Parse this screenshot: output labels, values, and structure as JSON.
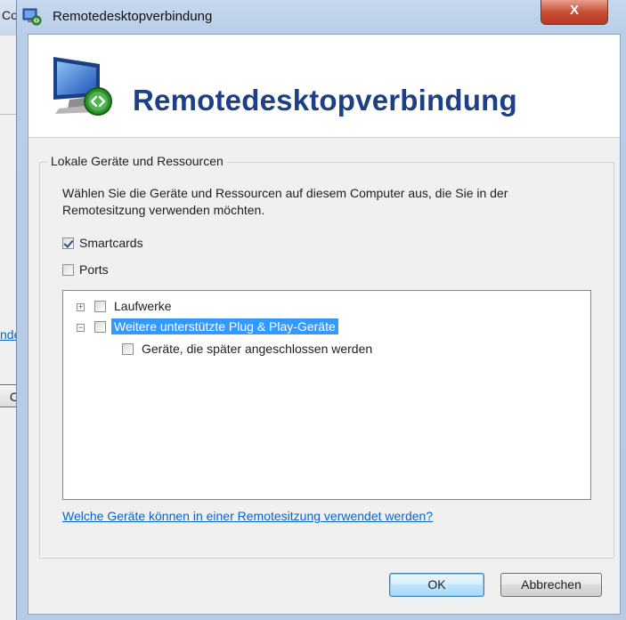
{
  "background_window": {
    "title_fragment": "Co",
    "link_fragment": "nde",
    "button_fragment": "C"
  },
  "dialog": {
    "title": "Remotedesktopverbindung",
    "close_label": "X",
    "banner_title": "Remotedesktopverbindung",
    "group_title": "Lokale Geräte und Ressourcen",
    "description": "Wählen Sie die Geräte und Ressourcen auf diesem Computer aus, die Sie in der Remotesitzung verwenden möchten.",
    "checkboxes": [
      {
        "label": "Smartcards",
        "checked": true
      },
      {
        "label": "Ports",
        "checked": false
      }
    ],
    "tree": [
      {
        "label": "Laufwerke",
        "expander": "+",
        "checked": false,
        "selected": false
      },
      {
        "label": "Weitere unterstützte Plug & Play-Geräte",
        "expander": "−",
        "checked": false,
        "selected": true
      },
      {
        "label": "Geräte, die später angeschlossen werden",
        "checked": false,
        "selected": false
      }
    ],
    "help_link": "Welche Geräte können in einer Remotesitzung verwendet werden?",
    "ok_label": "OK",
    "cancel_label": "Abbrechen"
  },
  "colors": {
    "accent": "#1d3f88",
    "selection": "#3399ff",
    "link": "#0a64c8",
    "close_button": "#c74b32"
  }
}
